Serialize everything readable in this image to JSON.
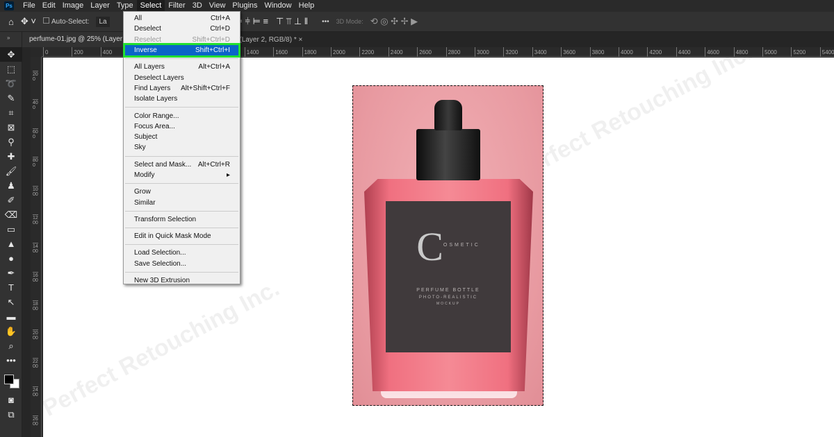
{
  "app": {
    "logo": "Ps"
  },
  "menubar": [
    "File",
    "Edit",
    "Image",
    "Layer",
    "Type",
    "Select",
    "Filter",
    "3D",
    "View",
    "Plugins",
    "Window",
    "Help"
  ],
  "active_menu": "Select",
  "options": {
    "auto_select": "Auto-Select:",
    "layer_field": "La",
    "mode_3d": "3D Mode:",
    "more": "•••"
  },
  "tabs": {
    "doc1": "perfume-01.jpg @ 25% (Layer",
    "doc2": "100% (Layer 2, RGB/8) *",
    "close": "×"
  },
  "ruler": {
    "h": [
      "0",
      "200",
      "400",
      "600",
      "800",
      "1000",
      "1200",
      "1400",
      "1600",
      "1800",
      "2000",
      "2200",
      "2400",
      "2600",
      "2800",
      "3000",
      "3200",
      "3400",
      "3600",
      "3800",
      "4000",
      "4200",
      "4400",
      "4600",
      "4800",
      "5000",
      "5200",
      "5400"
    ],
    "v": [
      "200",
      "400",
      "600",
      "800",
      "1000",
      "1200",
      "1400",
      "1600",
      "1800",
      "2000",
      "2200",
      "2400",
      "2600"
    ]
  },
  "tools": [
    "move-icon",
    "marquee-icon",
    "lasso-icon",
    "quick-select-icon",
    "crop-icon",
    "frame-icon",
    "eyedropper-icon",
    "healing-icon",
    "brush-icon",
    "stamp-icon",
    "history-brush-icon",
    "eraser-icon",
    "gradient-icon",
    "blur-icon",
    "dodge-icon",
    "pen-icon",
    "type-icon",
    "path-select-icon",
    "rectangle-icon",
    "hand-icon",
    "zoom-icon",
    "more-icon"
  ],
  "menu": [
    [
      {
        "label": "All",
        "sc": "Ctrl+A"
      },
      {
        "label": "Deselect",
        "sc": "Ctrl+D"
      },
      {
        "label": "Reselect",
        "sc": "Shift+Ctrl+D",
        "disabled": true
      },
      {
        "label": "Inverse",
        "sc": "Shift+Ctrl+I",
        "highlighted": true
      }
    ],
    [
      {
        "label": "All Layers",
        "sc": "Alt+Ctrl+A"
      },
      {
        "label": "Deselect Layers",
        "sc": ""
      },
      {
        "label": "Find Layers",
        "sc": "Alt+Shift+Ctrl+F"
      },
      {
        "label": "Isolate Layers",
        "sc": ""
      }
    ],
    [
      {
        "label": "Color Range...",
        "sc": ""
      },
      {
        "label": "Focus Area...",
        "sc": ""
      },
      {
        "label": "Subject",
        "sc": ""
      },
      {
        "label": "Sky",
        "sc": ""
      }
    ],
    [
      {
        "label": "Select and Mask...",
        "sc": "Alt+Ctrl+R"
      },
      {
        "label": "Modify",
        "sc": "▸"
      }
    ],
    [
      {
        "label": "Grow",
        "sc": ""
      },
      {
        "label": "Similar",
        "sc": ""
      }
    ],
    [
      {
        "label": "Transform Selection",
        "sc": ""
      }
    ],
    [
      {
        "label": "Edit in Quick Mask Mode",
        "sc": ""
      }
    ],
    [
      {
        "label": "Load Selection...",
        "sc": ""
      },
      {
        "label": "Save Selection...",
        "sc": ""
      }
    ],
    [
      {
        "label": "New 3D Extrusion",
        "sc": ""
      }
    ]
  ],
  "photo": {
    "letter": "C",
    "word": "OSMETIC",
    "line1": "PERFUME BOTTLE",
    "line2": "PHOTO-REALISTIC",
    "line3": "MOCKUP"
  },
  "watermark": "Perfect Retouching Inc.",
  "colors": {
    "highlight": "#0a64c8",
    "outline": "#22e030"
  }
}
